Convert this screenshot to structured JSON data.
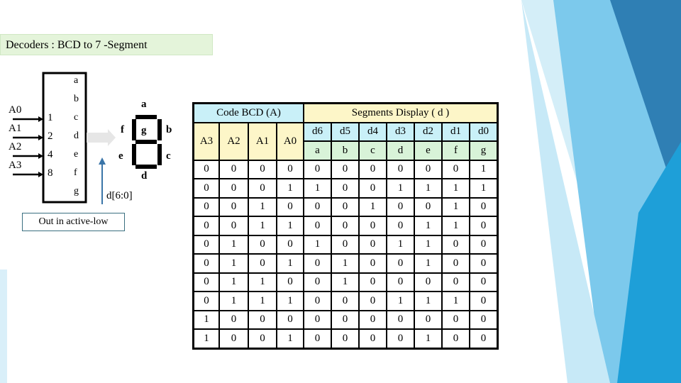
{
  "title": "Decoders : BCD to 7 -Segment",
  "decoder": {
    "outputs": [
      "a",
      "b",
      "c",
      "d",
      "e",
      "f",
      "g"
    ],
    "inputs": [
      {
        "name": "A0",
        "weight": "1"
      },
      {
        "name": "A1",
        "weight": "2"
      },
      {
        "name": "A2",
        "weight": "4"
      },
      {
        "name": "A3",
        "weight": "8"
      }
    ]
  },
  "display": {
    "segments": {
      "a": "a",
      "b": "b",
      "c": "c",
      "d": "d",
      "e": "e",
      "f": "f",
      "g": "g"
    }
  },
  "bus_label": "d[6:0]",
  "note": "Out in active-low",
  "table": {
    "group_bcd": "Code BCD (A)",
    "group_seg": "Segments Display ( d )",
    "bcd_cols": [
      "A3",
      "A2",
      "A1",
      "A0"
    ],
    "d_cols": [
      "d6",
      "d5",
      "d4",
      "d3",
      "d2",
      "d1",
      "d0"
    ],
    "seg_cols": [
      "a",
      "b",
      "c",
      "d",
      "e",
      "f",
      "g"
    ],
    "rows": [
      [
        "0",
        "0",
        "0",
        "0",
        "0",
        "0",
        "0",
        "0",
        "0",
        "0",
        "1"
      ],
      [
        "0",
        "0",
        "0",
        "1",
        "1",
        "0",
        "0",
        "1",
        "1",
        "1",
        "1"
      ],
      [
        "0",
        "0",
        "1",
        "0",
        "0",
        "0",
        "1",
        "0",
        "0",
        "1",
        "0"
      ],
      [
        "0",
        "0",
        "1",
        "1",
        "0",
        "0",
        "0",
        "0",
        "1",
        "1",
        "0"
      ],
      [
        "0",
        "1",
        "0",
        "0",
        "1",
        "0",
        "0",
        "1",
        "1",
        "0",
        "0"
      ],
      [
        "0",
        "1",
        "0",
        "1",
        "0",
        "1",
        "0",
        "0",
        "1",
        "0",
        "0"
      ],
      [
        "0",
        "1",
        "1",
        "0",
        "0",
        "1",
        "0",
        "0",
        "0",
        "0",
        "0"
      ],
      [
        "0",
        "1",
        "1",
        "1",
        "0",
        "0",
        "0",
        "1",
        "1",
        "1",
        "0"
      ],
      [
        "1",
        "0",
        "0",
        "0",
        "0",
        "0",
        "0",
        "0",
        "0",
        "0",
        "0"
      ],
      [
        "1",
        "0",
        "0",
        "1",
        "0",
        "0",
        "0",
        "0",
        "1",
        "0",
        "0"
      ]
    ]
  },
  "colors": {
    "header_blue": "#c9f0f8",
    "header_yellow": "#fdf6c8",
    "header_green": "#d8f3d8",
    "title_bg": "#e4f4da",
    "deco_blue": "#2a8fc8"
  }
}
